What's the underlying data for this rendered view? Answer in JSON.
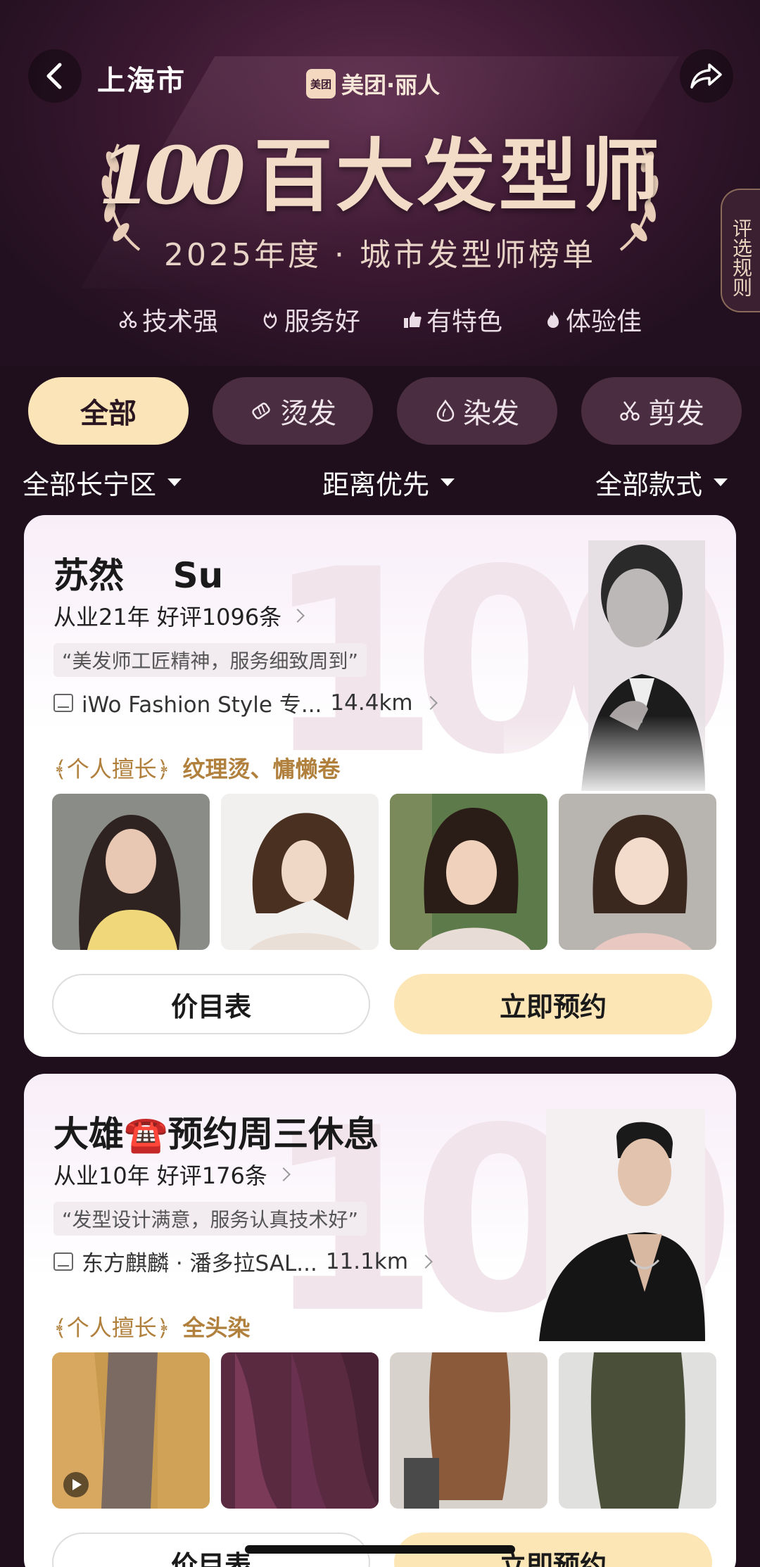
{
  "header": {
    "city": "上海市",
    "brand_logo": "美团",
    "brand_text": "美团·丽人",
    "title_number": "100",
    "title_text": "百大发型师",
    "subtitle": "2025年度 · 城市发型师榜单",
    "rules_label": "评选规则",
    "tags": [
      {
        "icon": "scissors-icon",
        "label": "技术强"
      },
      {
        "icon": "flower-icon",
        "label": "服务好"
      },
      {
        "icon": "thumb-icon",
        "label": "有特色"
      },
      {
        "icon": "flame-icon",
        "label": "体验佳"
      }
    ]
  },
  "categories": [
    {
      "label": "全部",
      "icon": "",
      "active": true
    },
    {
      "label": "烫发",
      "icon": "curler-icon",
      "active": false
    },
    {
      "label": "染发",
      "icon": "drop-icon",
      "active": false
    },
    {
      "label": "剪发",
      "icon": "scissors-icon",
      "active": false
    }
  ],
  "filters": {
    "district": "全部长宁区",
    "sort": "距离优先",
    "style": "全部款式"
  },
  "stylists": [
    {
      "name": "苏然    Su",
      "years": "从业21年",
      "reviews": "好评1096条",
      "quote": "“美发师工匠精神，服务细致周到”",
      "shop": "iWo Fashion Style 专...",
      "distance": "14.4km",
      "specialty_label": "﴾个人擅长﴿",
      "specialty": "纹理烫、慵懒卷",
      "price_button": "价目表",
      "book_button": "立即预约"
    },
    {
      "name": "大雄☎️预约周三休息",
      "years": "从业10年",
      "reviews": "好评176条",
      "quote": "“发型设计满意，服务认真技术好”",
      "shop": "东方麒麟 · 潘多拉SAL...",
      "distance": "11.1km",
      "specialty_label": "﴾个人擅长﴿",
      "specialty": "全头染",
      "price_button": "价目表",
      "book_button": "立即预约"
    }
  ],
  "colors": {
    "background": "#1f0f1c",
    "accent": "#fbe4b8",
    "specialty": "#b0803c"
  }
}
